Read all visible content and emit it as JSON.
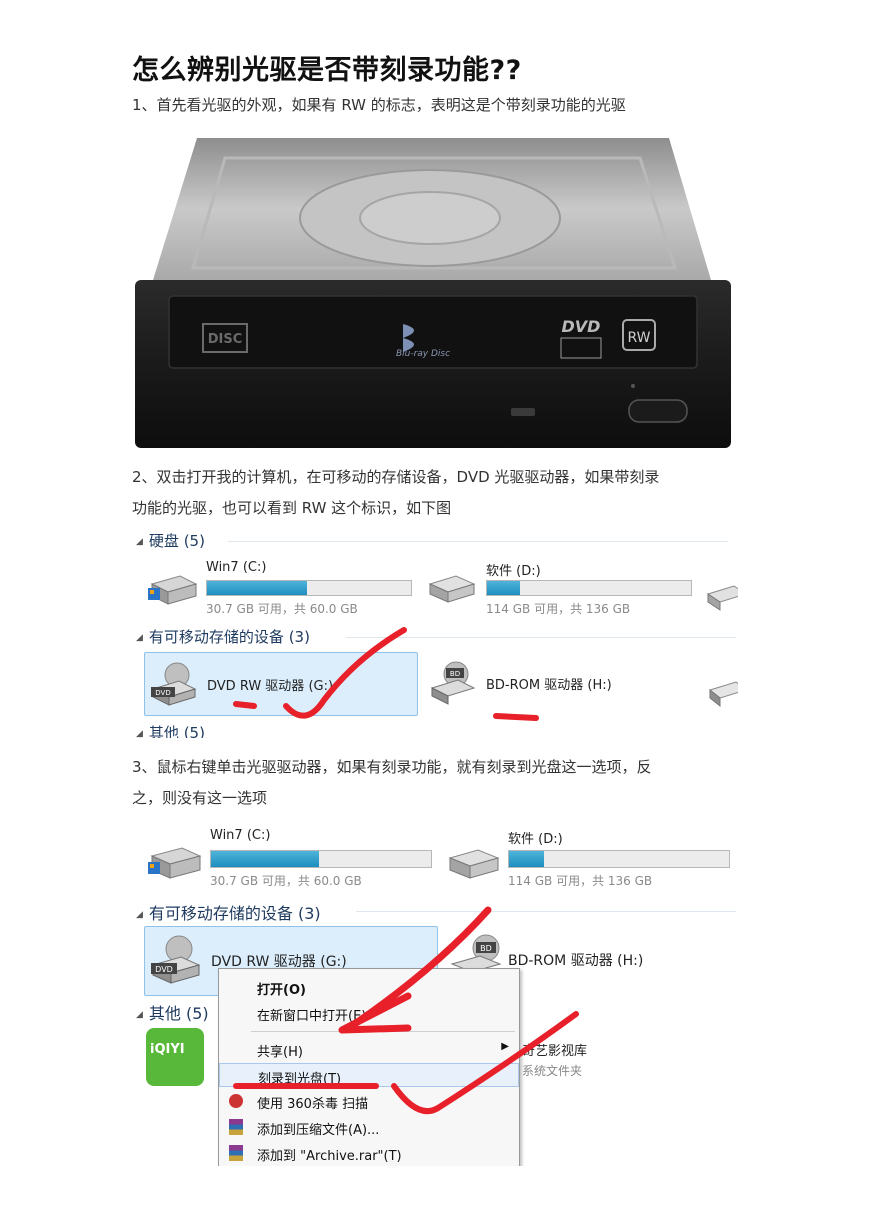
{
  "article": {
    "title": "怎么辨别光驱是否带刻录功能??",
    "step1": "1、首先看光驱的外观，如果有 RW 的标志，表明这是个带刻录功能的光驱",
    "step2_line1": "2、双击打开我的计算机，在可移动的存储设备，DVD 光驱驱动器，如果带刻录",
    "step2_line2": "功能的光驱，也可以看到 RW 这个标识，如下图",
    "step3_line1": "3、鼠标右键单击光驱驱动器，如果有刻录功能，就有刻录到光盘这一选项，反",
    "step3_line2": "之，则没有这一选项"
  },
  "photo": {
    "dvd_logo": "DVD",
    "rw_badge": "RW",
    "bluray_label": "Blu-ray Disc"
  },
  "explorer1": {
    "hdd_group": "硬盘 (5)",
    "removable_group": "有可移动存储的设备 (3)",
    "other_group": "其他 (5)",
    "drives": [
      {
        "name": "Win7 (C:)",
        "info": "30.7 GB 可用，共 60.0 GB",
        "used_fraction": 0.49
      },
      {
        "name": "软件 (D:)",
        "info": "114 GB 可用，共 136 GB",
        "used_fraction": 0.16
      }
    ],
    "dvd": "DVD RW 驱动器 (G:)",
    "bd": "BD-ROM 驱动器 (H:)",
    "dvd_icon_label": "DVD",
    "bd_icon_label": "BD"
  },
  "explorer2": {
    "removable_group": "有可移动存储的设备 (3)",
    "other_group": "其他 (5)",
    "drives": [
      {
        "name": "Win7 (C:)",
        "info": "30.7 GB 可用，共 60.0 GB",
        "used_fraction": 0.49
      },
      {
        "name": "软件 (D:)",
        "info": "114 GB 可用，共 136 GB",
        "used_fraction": 0.16
      }
    ],
    "dvd": "DVD RW 驱动器 (G:)",
    "bd": "BD-ROM 驱动器 (H:)",
    "dvd_icon_label": "DVD",
    "bd_icon_label": "BD",
    "iqiyi_label": "iQIYI",
    "iqiyi_name": "奇艺影视库",
    "iqiyi_sub": "系统文件夹",
    "menu": [
      "打开(O)",
      "在新窗口中打开(E)",
      "共享(H)",
      "刻录到光盘(T)",
      "使用 360杀毒 扫描",
      "添加到压缩文件(A)...",
      "添加到 \"Archive.rar\"(T)"
    ]
  },
  "colors": {
    "annotation": "#e8202a",
    "usage_bar": "#1c8fbf"
  }
}
